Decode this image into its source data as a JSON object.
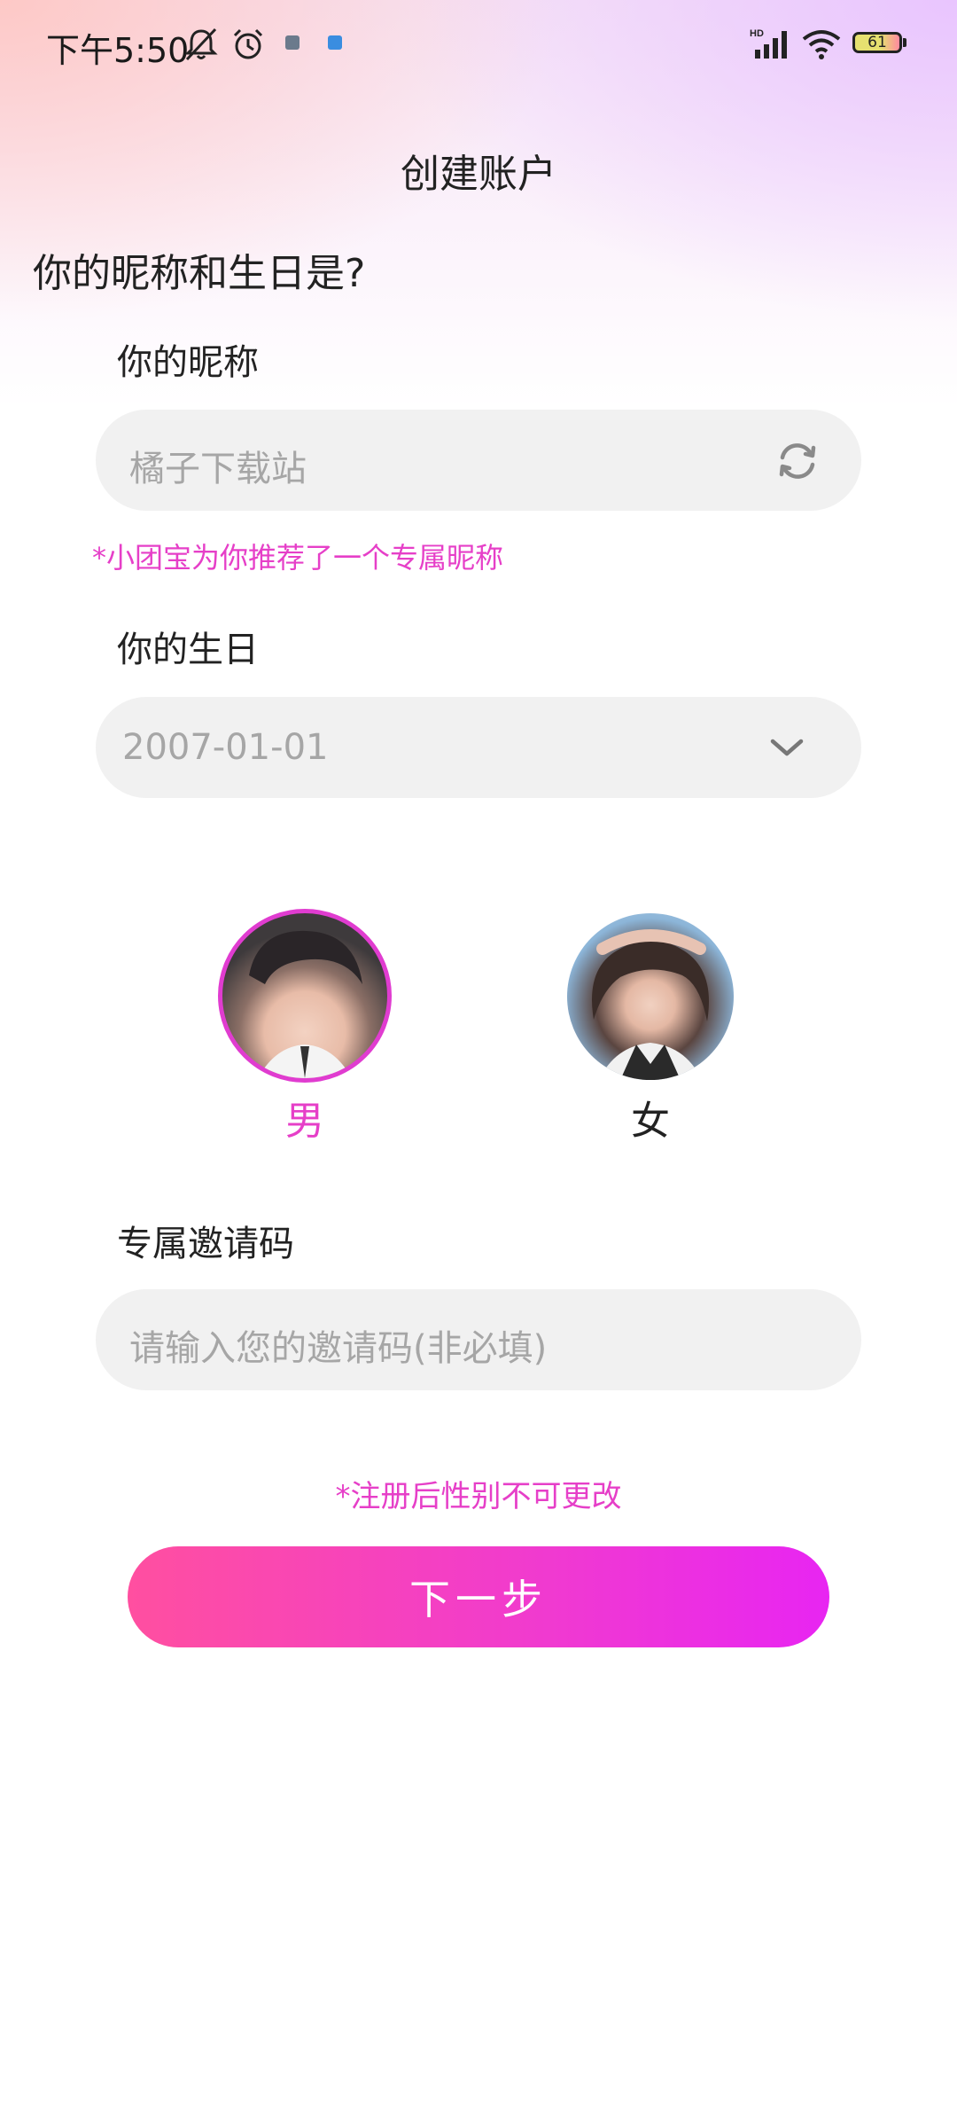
{
  "status_bar": {
    "time": "下午5:50",
    "battery": "61",
    "icons": [
      "mute-icon",
      "alarm-icon",
      "app-notification-icon",
      "app-notification-icon",
      "hd-signal-icon",
      "wifi-icon",
      "battery-icon"
    ]
  },
  "header": {
    "title": "创建账户"
  },
  "form": {
    "question": "你的昵称和生日是?",
    "nickname": {
      "label": "你的昵称",
      "value": "橘子下载站",
      "hint": "*小团宝为你推荐了一个专属昵称"
    },
    "birthday": {
      "label": "你的生日",
      "value": "2007-01-01"
    },
    "gender": {
      "options": [
        {
          "label": "男",
          "selected": true
        },
        {
          "label": "女",
          "selected": false
        }
      ]
    },
    "invite": {
      "label": "专属邀请码",
      "placeholder": "请输入您的邀请码(非必填)"
    },
    "notice": "*注册后性别不可更改",
    "next_label": "下一步"
  },
  "colors": {
    "accent": "#e63fc8",
    "button_gradient_start": "#ff4fa0",
    "button_gradient_end": "#e825f2",
    "field_bg": "#f1f1f1"
  }
}
